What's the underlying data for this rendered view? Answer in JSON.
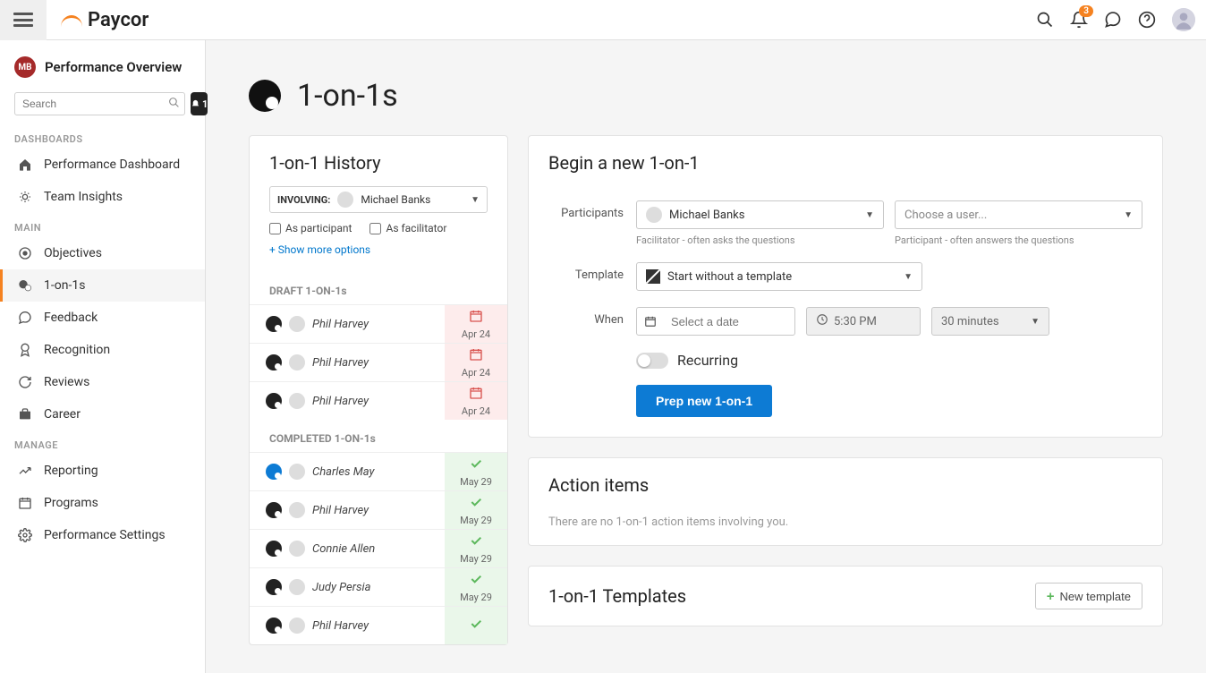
{
  "topbar": {
    "logo_text": "Paycor",
    "notif_count": "3"
  },
  "sidebar": {
    "avatar_initials": "MB",
    "title": "Performance Overview",
    "search_placeholder": "Search",
    "bell_count": "1",
    "sections": {
      "dashboards": "DASHBOARDS",
      "main": "MAIN",
      "manage": "MANAGE"
    },
    "items": {
      "perf_dash": "Performance Dashboard",
      "team_insights": "Team Insights",
      "objectives": "Objectives",
      "one_on_ones": "1-on-1s",
      "feedback": "Feedback",
      "recognition": "Recognition",
      "reviews": "Reviews",
      "career": "Career",
      "reporting": "Reporting",
      "programs": "Programs",
      "perf_settings": "Performance Settings"
    }
  },
  "page": {
    "title": "1-on-1s"
  },
  "history": {
    "title": "1-on-1 History",
    "involving_label": "INVOLVING:",
    "involving_value": "Michael Banks",
    "as_participant": "As participant",
    "as_facilitator": "As facilitator",
    "show_more": "Show more options",
    "draft_label": "DRAFT 1-ON-1s",
    "completed_label": "COMPLETED 1-ON-1s",
    "drafts": [
      {
        "name": "Phil Harvey",
        "date": "Apr 24"
      },
      {
        "name": "Phil Harvey",
        "date": "Apr 24"
      },
      {
        "name": "Phil Harvey",
        "date": "Apr 24"
      }
    ],
    "completed": [
      {
        "name": "Charles May",
        "date": "May 29",
        "blue": true
      },
      {
        "name": "Phil Harvey",
        "date": "May 29"
      },
      {
        "name": "Connie Allen",
        "date": "May 29"
      },
      {
        "name": "Judy Persia",
        "date": "May 29"
      },
      {
        "name": "Phil Harvey",
        "date": ""
      }
    ]
  },
  "new": {
    "title": "Begin a new 1-on-1",
    "labels": {
      "participants": "Participants",
      "template": "Template",
      "when": "When",
      "recurring": "Recurring"
    },
    "facilitator_value": "Michael Banks",
    "facilitator_hint": "Facilitator - often asks the questions",
    "participant_placeholder": "Choose a user...",
    "participant_hint": "Participant - often answers the questions",
    "template_value": "Start without a template",
    "date_placeholder": "Select a date",
    "time_value": "5:30 PM",
    "duration_value": "30 minutes",
    "prep_btn": "Prep new 1-on-1"
  },
  "action_items": {
    "title": "Action items",
    "empty": "There are no 1-on-1 action items involving you."
  },
  "templates": {
    "title": "1-on-1 Templates",
    "new_btn": "New template"
  }
}
